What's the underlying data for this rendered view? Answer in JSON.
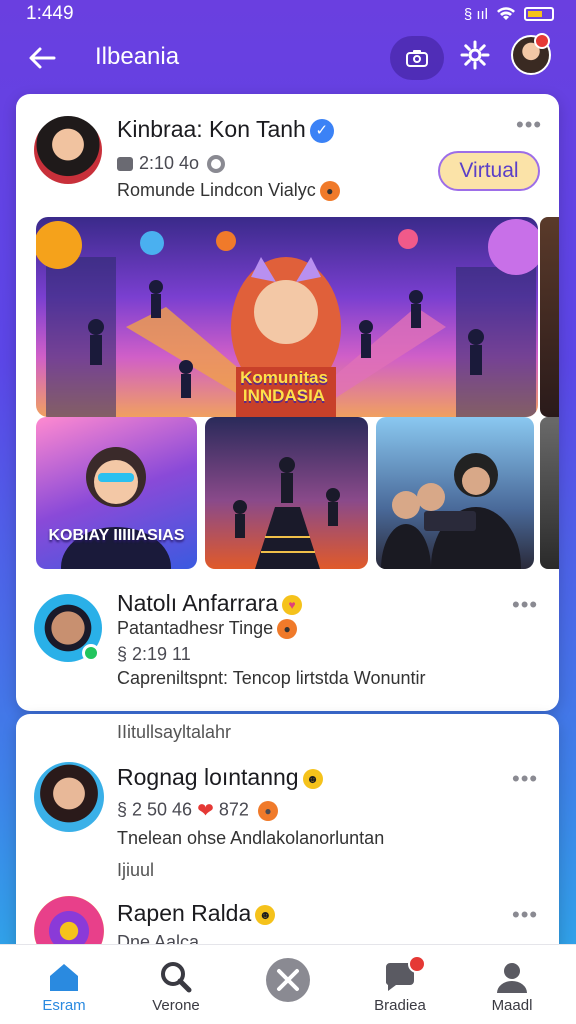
{
  "status_bar": {
    "time": "1:449",
    "signal": "§ ııl",
    "wifi": "wifi"
  },
  "app_bar": {
    "title": "Ilbeania"
  },
  "post1": {
    "author": "Kinbraa: Kon Tanh",
    "meta": "2:10 4o",
    "subtitle": "Romunde Lindcon Vialyc",
    "action_label": "Virtual",
    "hero_banner": "Komunitas INNDASIA",
    "thumb1_label": "KOBIAY IIIIIASIAS"
  },
  "post2": {
    "author": "Natolı Anfarrara",
    "subtitle": "Patantadhesr Tinge",
    "meta": "§ 2:19 11",
    "caption": "Capreniltspnt: Tencop lirtstda Wonuntir"
  },
  "post3": {
    "prev_line": "IIitullsayltalahr",
    "author": "Rognag loıntanng",
    "meta_count": "§ 2 50 46",
    "meta_likes": "872",
    "caption": "Tnelean ohse Andlakolanorluntan",
    "extra": "Ijiuul"
  },
  "post4": {
    "author": "Rapen Ralda",
    "meta": "Dne Aalca"
  },
  "bottom_nav": [
    {
      "label": "Esram",
      "icon": "home-icon"
    },
    {
      "label": "Verone",
      "icon": "search-icon"
    },
    {
      "label": "",
      "icon": "create-icon"
    },
    {
      "label": "Bradiea",
      "icon": "chat-icon"
    },
    {
      "label": "Maadl",
      "icon": "profile-icon"
    }
  ],
  "colors": {
    "accent": "#5b46e6",
    "active_nav": "#2a8ae0",
    "verified": "#3b82f6"
  }
}
